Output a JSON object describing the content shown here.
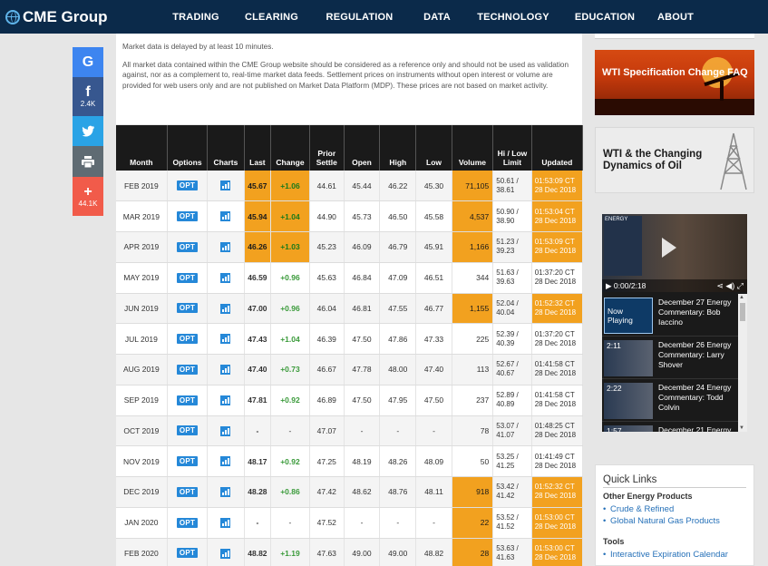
{
  "header": {
    "logo": "CME Group",
    "nav": [
      "TRADING",
      "CLEARING",
      "REGULATION",
      "DATA",
      "TECHNOLOGY",
      "EDUCATION",
      "ABOUT"
    ]
  },
  "social": {
    "facebook_count": "2.4K",
    "share_count": "44.1K"
  },
  "notice": {
    "delay": "Market data is delayed by at least 10 minutes.",
    "disclaimer": "All market data contained within the CME Group website should be considered as a reference only and should not be used as validation against, nor as a complement to, real-time market data feeds. Settlement prices on instruments without open interest or volume are provided for web users only and are not published on Market Data Platform (MDP). These prices are not based on market activity."
  },
  "table": {
    "headers": [
      "Month",
      "Options",
      "Charts",
      "Last",
      "Change",
      "Prior Settle",
      "Open",
      "High",
      "Low",
      "Volume",
      "Hi / Low Limit",
      "Updated"
    ],
    "opt_label": "OPT",
    "rows": [
      {
        "month": "FEB 2019",
        "last": "45.67",
        "change": "+1.06",
        "prior": "44.61",
        "open": "45.44",
        "high": "46.22",
        "low": "45.30",
        "volume": "71,105",
        "hi": "50.61 /",
        "lo": "38.61",
        "time": "01:53:09 CT",
        "date": "28 Dec 2018",
        "hl": true,
        "vhl": true
      },
      {
        "month": "MAR 2019",
        "last": "45.94",
        "change": "+1.04",
        "prior": "44.90",
        "open": "45.73",
        "high": "46.50",
        "low": "45.58",
        "volume": "4,537",
        "hi": "50.90 /",
        "lo": "38.90",
        "time": "01:53:04 CT",
        "date": "28 Dec 2018",
        "hl": true,
        "vhl": true
      },
      {
        "month": "APR 2019",
        "last": "46.26",
        "change": "+1.03",
        "prior": "45.23",
        "open": "46.09",
        "high": "46.79",
        "low": "45.91",
        "volume": "1,166",
        "hi": "51.23 /",
        "lo": "39.23",
        "time": "01:53:09 CT",
        "date": "28 Dec 2018",
        "hl": true,
        "vhl": true
      },
      {
        "month": "MAY 2019",
        "last": "46.59",
        "change": "+0.96",
        "prior": "45.63",
        "open": "46.84",
        "high": "47.09",
        "low": "46.51",
        "volume": "344",
        "hi": "51.63 /",
        "lo": "39.63",
        "time": "01:37:20 CT",
        "date": "28 Dec 2018",
        "hl": false,
        "vhl": false
      },
      {
        "month": "JUN 2019",
        "last": "47.00",
        "change": "+0.96",
        "prior": "46.04",
        "open": "46.81",
        "high": "47.55",
        "low": "46.77",
        "volume": "1,155",
        "hi": "52.04 /",
        "lo": "40.04",
        "time": "01:52:32 CT",
        "date": "28 Dec 2018",
        "hl": false,
        "vhl": true
      },
      {
        "month": "JUL 2019",
        "last": "47.43",
        "change": "+1.04",
        "prior": "46.39",
        "open": "47.50",
        "high": "47.86",
        "low": "47.33",
        "volume": "225",
        "hi": "52.39 /",
        "lo": "40.39",
        "time": "01:37:20 CT",
        "date": "28 Dec 2018",
        "hl": false,
        "vhl": false
      },
      {
        "month": "AUG 2019",
        "last": "47.40",
        "change": "+0.73",
        "prior": "46.67",
        "open": "47.78",
        "high": "48.00",
        "low": "47.40",
        "volume": "113",
        "hi": "52.67 /",
        "lo": "40.67",
        "time": "01:41:58 CT",
        "date": "28 Dec 2018",
        "hl": false,
        "vhl": false
      },
      {
        "month": "SEP 2019",
        "last": "47.81",
        "change": "+0.92",
        "prior": "46.89",
        "open": "47.50",
        "high": "47.95",
        "low": "47.50",
        "volume": "237",
        "hi": "52.89 /",
        "lo": "40.89",
        "time": "01:41:58 CT",
        "date": "28 Dec 2018",
        "hl": false,
        "vhl": false
      },
      {
        "month": "OCT 2019",
        "last": "-",
        "change": "-",
        "prior": "47.07",
        "open": "-",
        "high": "-",
        "low": "-",
        "volume": "78",
        "hi": "53.07 /",
        "lo": "41.07",
        "time": "01:48:25 CT",
        "date": "28 Dec 2018",
        "hl": false,
        "vhl": false
      },
      {
        "month": "NOV 2019",
        "last": "48.17",
        "change": "+0.92",
        "prior": "47.25",
        "open": "48.19",
        "high": "48.26",
        "low": "48.09",
        "volume": "50",
        "hi": "53.25 /",
        "lo": "41.25",
        "time": "01:41:49 CT",
        "date": "28 Dec 2018",
        "hl": false,
        "vhl": false
      },
      {
        "month": "DEC 2019",
        "last": "48.28",
        "change": "+0.86",
        "prior": "47.42",
        "open": "48.62",
        "high": "48.76",
        "low": "48.11",
        "volume": "918",
        "hi": "53.42 /",
        "lo": "41.42",
        "time": "01:52:32 CT",
        "date": "28 Dec 2018",
        "hl": false,
        "vhl": true
      },
      {
        "month": "JAN 2020",
        "last": "-",
        "change": "-",
        "prior": "47.52",
        "open": "-",
        "high": "-",
        "low": "-",
        "volume": "22",
        "hi": "53.52 /",
        "lo": "41.52",
        "time": "01:53:00 CT",
        "date": "28 Dec 2018",
        "hl": false,
        "vhl": true
      },
      {
        "month": "FEB 2020",
        "last": "48.82",
        "change": "+1.19",
        "prior": "47.63",
        "open": "49.00",
        "high": "49.00",
        "low": "48.82",
        "volume": "28",
        "hi": "53.63 /",
        "lo": "41.63",
        "time": "01:53:00 CT",
        "date": "28 Dec 2018",
        "hl": false,
        "vhl": true
      }
    ]
  },
  "sidebar": {
    "promo1": "WTI Specification Change FAQ",
    "promo2": "WTI & the Changing Dynamics of Oil",
    "video": {
      "time": "0:00/2:18",
      "items": [
        {
          "thumb": "Now Playing",
          "title": "December 27 Energy Commentary: Bob Iaccino"
        },
        {
          "thumb": "2:11",
          "title": "December 26 Energy Commentary: Larry Shover"
        },
        {
          "thumb": "2:22",
          "title": "December 24 Energy Commentary: Todd Colvin"
        },
        {
          "thumb": "1:57",
          "title": "December 21 Energy"
        }
      ]
    },
    "quick_links": {
      "title": "Quick Links",
      "other_heading": "Other Energy Products",
      "other": [
        "Crude & Refined",
        "Global Natural Gas Products"
      ],
      "tools_heading": "Tools",
      "tools": [
        "Interactive Expiration Calendar"
      ]
    }
  }
}
